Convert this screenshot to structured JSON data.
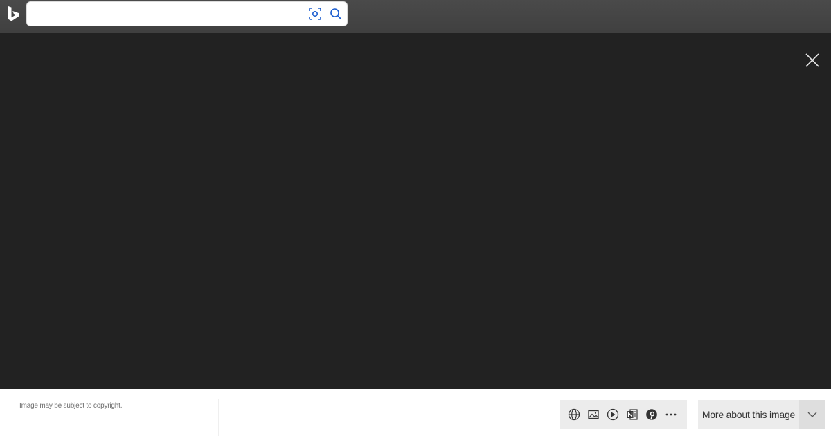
{
  "header": {
    "logo_icon": "bing-logo-icon",
    "search": {
      "value": "",
      "placeholder": ""
    },
    "visual_search_icon": "visual-search-icon",
    "search_icon": "search-icon"
  },
  "viewer": {
    "close_icon": "close-icon"
  },
  "footer": {
    "copyright": "Image may be subject to copyright.",
    "actions": [
      {
        "icon": "globe-icon"
      },
      {
        "icon": "image-icon"
      },
      {
        "icon": "play-icon"
      },
      {
        "icon": "onenote-icon"
      },
      {
        "icon": "pinterest-icon"
      },
      {
        "icon": "more-icon"
      }
    ],
    "more_label": "More about this image",
    "more_caret_icon": "chevron-down-icon"
  },
  "colors": {
    "topbar": "#444444",
    "viewer_bg": "#222222",
    "accent": "#1a5ccf",
    "footer_bg": "#ffffff",
    "button_bg": "#ececec"
  }
}
